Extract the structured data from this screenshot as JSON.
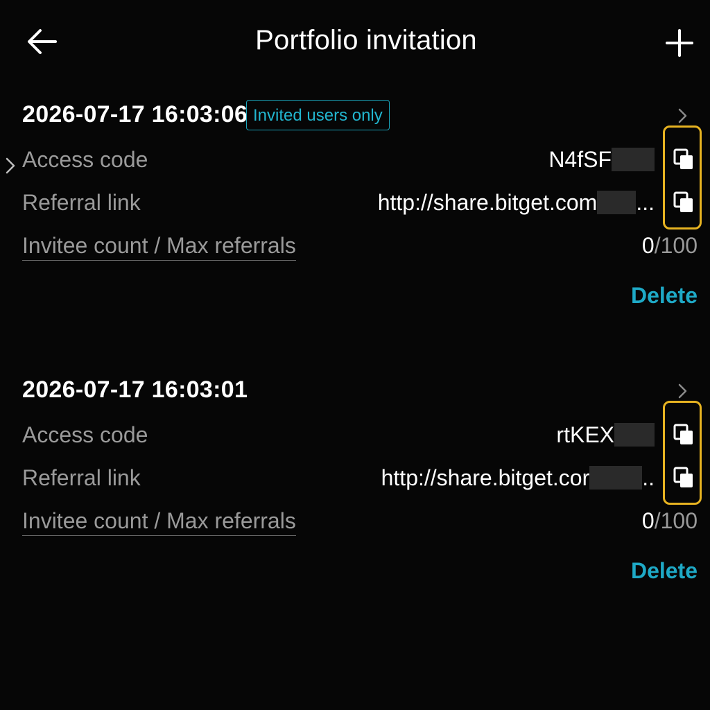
{
  "header": {
    "title": "Portfolio invitation",
    "back_icon": "arrow-left-icon",
    "add_icon": "plus-icon"
  },
  "colors": {
    "background": "#060606",
    "accent": "#1ea9c6",
    "highlight": "#e7b321",
    "muted": "#9a9a9a"
  },
  "invitations": [
    {
      "date": "2026-07-17 16:03:06",
      "badge": "Invited users only",
      "access_code_label": "Access code",
      "access_code": "N4fSF",
      "referral_link_label": "Referral link",
      "referral_link": "http://share.bitget.com",
      "referral_link_ellipsis": "...",
      "count_label": "Invitee count / Max referrals",
      "invitee_count": "0",
      "count_separator": "/",
      "max_referrals": "100",
      "delete_label": "Delete"
    },
    {
      "date": "2026-07-17 16:03:01",
      "access_code_label": "Access code",
      "access_code": "rtKEX",
      "referral_link_label": "Referral link",
      "referral_link": "http://share.bitget.cor",
      "referral_link_ellipsis": "..",
      "count_label": "Invitee count / Max referrals",
      "invitee_count": "0",
      "count_separator": "/",
      "max_referrals": "100",
      "delete_label": "Delete"
    }
  ]
}
